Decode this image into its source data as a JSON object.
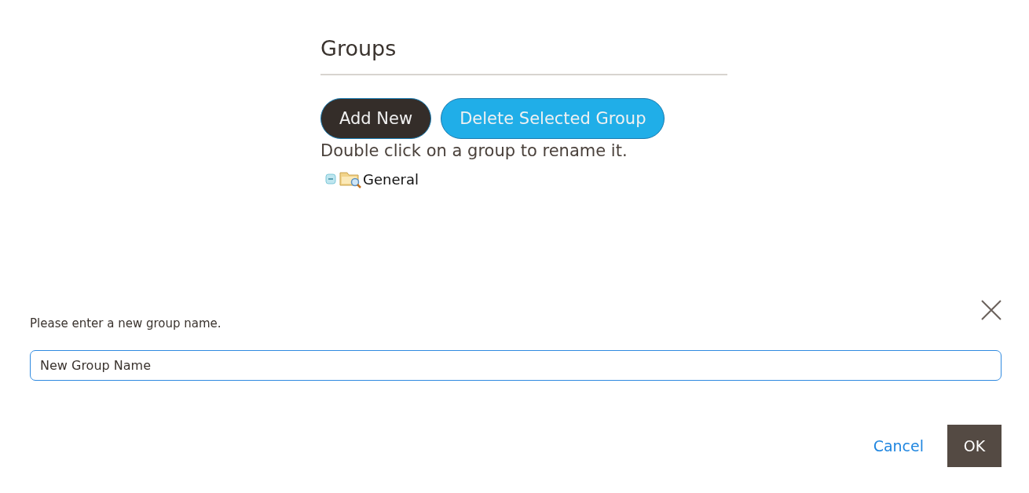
{
  "preview": {
    "title": "Groups",
    "buttons": [
      {
        "label": "Add New",
        "kind": "dark"
      },
      {
        "label": "Delete Selected Group",
        "kind": "blue"
      }
    ],
    "hint": "Double click on a group to rename it.",
    "tree": [
      {
        "label": "General",
        "expanded": true
      }
    ]
  },
  "dialog": {
    "prompt": "Please enter a new group name.",
    "value": "New Group Name",
    "buttons": [
      {
        "label": "Cancel",
        "kind": "link"
      },
      {
        "label": "OK",
        "kind": "primary"
      }
    ]
  }
}
